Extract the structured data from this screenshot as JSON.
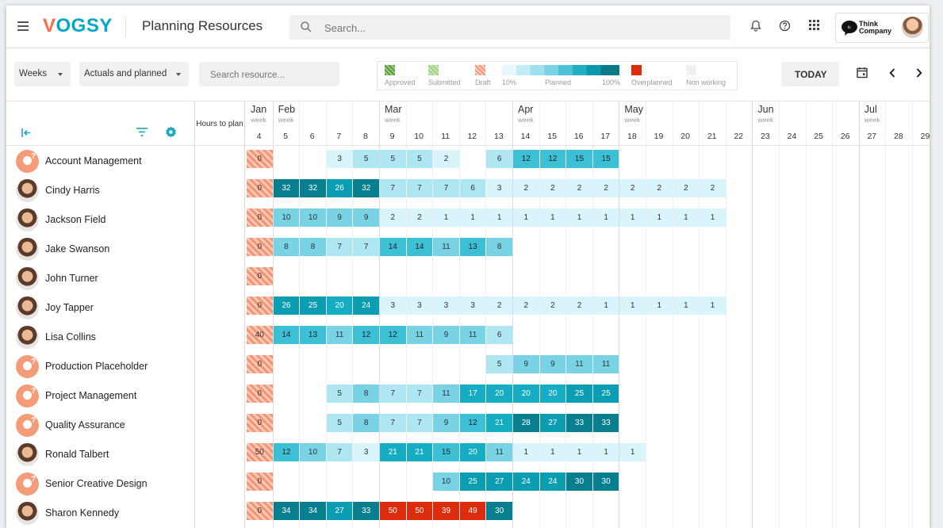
{
  "topbar": {
    "logo_first": "V",
    "logo_rest": "OGSY",
    "title": "Planning Resources",
    "search_placeholder": "Search...",
    "brand_line1": "Think",
    "brand_line2": "Company"
  },
  "toolbar": {
    "period": "Weeks",
    "mode": "Actuals and planned",
    "resource_search_placeholder": "Search resource...",
    "today": "TODAY"
  },
  "legend": {
    "approved": "Approved",
    "submitted": "Submitted",
    "draft": "Draft",
    "min_pct": "10%",
    "planned": "Planned",
    "max_pct": "100%",
    "overplanned": "Overplanned",
    "non_working": "Non working",
    "colors": {
      "approved": "#5a9c3c",
      "submitted": "#9bd17c",
      "draft": "#f39576",
      "overplanned": "#dd2c0c",
      "non_working": "#f2f2f2"
    }
  },
  "grid": {
    "hours_to_plan": "Hours to plan",
    "months": [
      {
        "label": "Jan",
        "sub": "week"
      },
      {
        "label": "Feb",
        "sub": "week"
      },
      {
        "label": "Mar",
        "sub": "week"
      },
      {
        "label": "Apr",
        "sub": "week"
      },
      {
        "label": "May",
        "sub": "week"
      },
      {
        "label": "Jun",
        "sub": "week"
      },
      {
        "label": "Jul",
        "sub": "week"
      }
    ],
    "weeks": [
      "4",
      "5",
      "6",
      "7",
      "8",
      "9",
      "10",
      "11",
      "12",
      "13",
      "14",
      "15",
      "16",
      "17",
      "18",
      "19",
      "20",
      "21",
      "22",
      "23",
      "24",
      "25",
      "26",
      "27",
      "28",
      "29"
    ]
  },
  "rows": [
    {
      "name": "Account Management",
      "avatar": "placeholder-icon",
      "cells": [
        {
          "w": 4,
          "v": "0",
          "draft": true
        },
        {
          "w": 7,
          "v": "3"
        },
        {
          "w": 8,
          "v": "5"
        },
        {
          "w": 9,
          "v": "5"
        },
        {
          "w": 10,
          "v": "5"
        },
        {
          "w": 11,
          "v": "2"
        },
        {
          "w": 13,
          "v": "6"
        },
        {
          "w": 14,
          "v": "12"
        },
        {
          "w": 15,
          "v": "12"
        },
        {
          "w": 16,
          "v": "15"
        },
        {
          "w": 17,
          "v": "15"
        }
      ]
    },
    {
      "name": "Cindy Harris",
      "avatar": "person-photo",
      "cells": [
        {
          "w": 4,
          "v": "0",
          "draft": true
        },
        {
          "w": 5,
          "v": "32"
        },
        {
          "w": 6,
          "v": "32"
        },
        {
          "w": 7,
          "v": "26"
        },
        {
          "w": 8,
          "v": "32"
        },
        {
          "w": 9,
          "v": "7"
        },
        {
          "w": 10,
          "v": "7"
        },
        {
          "w": 11,
          "v": "7"
        },
        {
          "w": 12,
          "v": "6"
        },
        {
          "w": 13,
          "v": "3"
        },
        {
          "w": 14,
          "v": "2"
        },
        {
          "w": 15,
          "v": "2"
        },
        {
          "w": 16,
          "v": "2"
        },
        {
          "w": 17,
          "v": "2"
        },
        {
          "w": 18,
          "v": "2"
        },
        {
          "w": 19,
          "v": "2"
        },
        {
          "w": 20,
          "v": "2"
        },
        {
          "w": 21,
          "v": "2"
        }
      ]
    },
    {
      "name": "Jackson Field",
      "avatar": "person-photo",
      "cells": [
        {
          "w": 4,
          "v": "0",
          "draft": true
        },
        {
          "w": 5,
          "v": "10"
        },
        {
          "w": 6,
          "v": "10"
        },
        {
          "w": 7,
          "v": "9"
        },
        {
          "w": 8,
          "v": "9"
        },
        {
          "w": 9,
          "v": "2"
        },
        {
          "w": 10,
          "v": "2"
        },
        {
          "w": 11,
          "v": "1"
        },
        {
          "w": 12,
          "v": "1"
        },
        {
          "w": 13,
          "v": "1"
        },
        {
          "w": 14,
          "v": "1"
        },
        {
          "w": 15,
          "v": "1"
        },
        {
          "w": 16,
          "v": "1"
        },
        {
          "w": 17,
          "v": "1"
        },
        {
          "w": 18,
          "v": "1"
        },
        {
          "w": 19,
          "v": "1"
        },
        {
          "w": 20,
          "v": "1"
        },
        {
          "w": 21,
          "v": "1"
        }
      ]
    },
    {
      "name": "Jake Swanson",
      "avatar": "person-photo",
      "cells": [
        {
          "w": 4,
          "v": "0",
          "draft": true
        },
        {
          "w": 5,
          "v": "8"
        },
        {
          "w": 6,
          "v": "8"
        },
        {
          "w": 7,
          "v": "7"
        },
        {
          "w": 8,
          "v": "7"
        },
        {
          "w": 9,
          "v": "14"
        },
        {
          "w": 10,
          "v": "14"
        },
        {
          "w": 11,
          "v": "11"
        },
        {
          "w": 12,
          "v": "13"
        },
        {
          "w": 13,
          "v": "8"
        }
      ]
    },
    {
      "name": "John Turner",
      "avatar": "person-photo",
      "cells": [
        {
          "w": 4,
          "v": "0",
          "draft": true
        }
      ]
    },
    {
      "name": "Joy Tapper",
      "avatar": "person-photo",
      "cells": [
        {
          "w": 4,
          "v": "0",
          "draft": true
        },
        {
          "w": 5,
          "v": "26"
        },
        {
          "w": 6,
          "v": "25"
        },
        {
          "w": 7,
          "v": "20"
        },
        {
          "w": 8,
          "v": "24"
        },
        {
          "w": 9,
          "v": "3"
        },
        {
          "w": 10,
          "v": "3"
        },
        {
          "w": 11,
          "v": "3"
        },
        {
          "w": 12,
          "v": "3"
        },
        {
          "w": 13,
          "v": "2"
        },
        {
          "w": 14,
          "v": "2"
        },
        {
          "w": 15,
          "v": "2"
        },
        {
          "w": 16,
          "v": "2"
        },
        {
          "w": 17,
          "v": "1"
        },
        {
          "w": 18,
          "v": "1"
        },
        {
          "w": 19,
          "v": "1"
        },
        {
          "w": 20,
          "v": "1"
        },
        {
          "w": 21,
          "v": "1"
        }
      ]
    },
    {
      "name": "Lisa Collins",
      "avatar": "person-photo",
      "cells": [
        {
          "w": 4,
          "v": "40",
          "draft": true
        },
        {
          "w": 5,
          "v": "14"
        },
        {
          "w": 6,
          "v": "13"
        },
        {
          "w": 7,
          "v": "11"
        },
        {
          "w": 8,
          "v": "12"
        },
        {
          "w": 9,
          "v": "12"
        },
        {
          "w": 10,
          "v": "11"
        },
        {
          "w": 11,
          "v": "9"
        },
        {
          "w": 12,
          "v": "11"
        },
        {
          "w": 13,
          "v": "6"
        }
      ]
    },
    {
      "name": "Production Placeholder",
      "avatar": "placeholder-icon",
      "cells": [
        {
          "w": 4,
          "v": "0",
          "draft": true
        },
        {
          "w": 13,
          "v": "5"
        },
        {
          "w": 14,
          "v": "9"
        },
        {
          "w": 15,
          "v": "9"
        },
        {
          "w": 16,
          "v": "11"
        },
        {
          "w": 17,
          "v": "11"
        }
      ]
    },
    {
      "name": "Project Management",
      "avatar": "placeholder-icon",
      "cells": [
        {
          "w": 4,
          "v": "0",
          "draft": true
        },
        {
          "w": 7,
          "v": "5"
        },
        {
          "w": 8,
          "v": "8"
        },
        {
          "w": 9,
          "v": "7"
        },
        {
          "w": 10,
          "v": "7"
        },
        {
          "w": 11,
          "v": "11"
        },
        {
          "w": 12,
          "v": "17"
        },
        {
          "w": 13,
          "v": "20"
        },
        {
          "w": 14,
          "v": "20"
        },
        {
          "w": 15,
          "v": "20"
        },
        {
          "w": 16,
          "v": "25"
        },
        {
          "w": 17,
          "v": "25"
        }
      ]
    },
    {
      "name": "Quality Assurance",
      "avatar": "placeholder-icon",
      "cells": [
        {
          "w": 4,
          "v": "0",
          "draft": true
        },
        {
          "w": 7,
          "v": "5"
        },
        {
          "w": 8,
          "v": "8"
        },
        {
          "w": 9,
          "v": "7"
        },
        {
          "w": 10,
          "v": "7"
        },
        {
          "w": 11,
          "v": "9"
        },
        {
          "w": 12,
          "v": "12"
        },
        {
          "w": 13,
          "v": "21"
        },
        {
          "w": 14,
          "v": "28"
        },
        {
          "w": 15,
          "v": "27"
        },
        {
          "w": 16,
          "v": "33"
        },
        {
          "w": 17,
          "v": "33"
        }
      ]
    },
    {
      "name": "Ronald Talbert",
      "avatar": "person-photo",
      "cells": [
        {
          "w": 4,
          "v": "50",
          "draft": true
        },
        {
          "w": 5,
          "v": "12"
        },
        {
          "w": 6,
          "v": "10"
        },
        {
          "w": 7,
          "v": "7"
        },
        {
          "w": 8,
          "v": "3"
        },
        {
          "w": 9,
          "v": "21"
        },
        {
          "w": 10,
          "v": "21"
        },
        {
          "w": 11,
          "v": "15"
        },
        {
          "w": 12,
          "v": "20"
        },
        {
          "w": 13,
          "v": "11"
        },
        {
          "w": 14,
          "v": "1"
        },
        {
          "w": 15,
          "v": "1"
        },
        {
          "w": 16,
          "v": "1"
        },
        {
          "w": 17,
          "v": "1"
        },
        {
          "w": 18,
          "v": "1"
        }
      ]
    },
    {
      "name": "Senior Creative Design",
      "avatar": "placeholder-icon",
      "cells": [
        {
          "w": 4,
          "v": "0",
          "draft": true
        },
        {
          "w": 11,
          "v": "10"
        },
        {
          "w": 12,
          "v": "25"
        },
        {
          "w": 13,
          "v": "27"
        },
        {
          "w": 14,
          "v": "24"
        },
        {
          "w": 15,
          "v": "24"
        },
        {
          "w": 16,
          "v": "30"
        },
        {
          "w": 17,
          "v": "30"
        }
      ]
    },
    {
      "name": "Sharon Kennedy",
      "avatar": "person-photo",
      "cells": [
        {
          "w": 4,
          "v": "0",
          "draft": true
        },
        {
          "w": 5,
          "v": "34"
        },
        {
          "w": 6,
          "v": "34"
        },
        {
          "w": 7,
          "v": "27"
        },
        {
          "w": 8,
          "v": "33"
        },
        {
          "w": 9,
          "v": "50",
          "over": true
        },
        {
          "w": 10,
          "v": "50",
          "over": true
        },
        {
          "w": 11,
          "v": "39",
          "over": true
        },
        {
          "w": 12,
          "v": "49",
          "over": true
        },
        {
          "w": 13,
          "v": "30"
        }
      ]
    }
  ]
}
